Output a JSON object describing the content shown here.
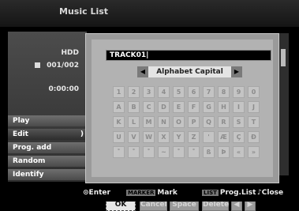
{
  "title": "Music List",
  "info": {
    "source": "HDD",
    "track_count": "001/002",
    "time": "0:00:00"
  },
  "menu": [
    {
      "label": "Play"
    },
    {
      "label": "Edit",
      "arrow": ")"
    },
    {
      "label": "Prog. add"
    },
    {
      "label": "Random"
    },
    {
      "label": "Identify"
    }
  ],
  "dialog": {
    "name_value": "TRACK01",
    "mode_label": "Alphabet Capital",
    "mode_left": "◀",
    "mode_right": "▶",
    "keys": [
      [
        "1",
        "2",
        "3",
        "4",
        "5",
        "6",
        "7",
        "8",
        "9",
        "0"
      ],
      [
        "A",
        "B",
        "C",
        "D",
        "E",
        "F",
        "G",
        "H",
        "I",
        "J"
      ],
      [
        "K",
        "L",
        "M",
        "N",
        "O",
        "P",
        "Q",
        "R",
        "S",
        "T"
      ],
      [
        "U",
        "V",
        "W",
        "X",
        "Y",
        "Z",
        "'",
        "Æ",
        "Ç",
        "Ð"
      ],
      [
        "˚",
        "˚",
        "˚",
        "~",
        "˚",
        "˚",
        "ß",
        "Þ",
        "«",
        "»"
      ]
    ],
    "buttons": {
      "ok": "OK",
      "cancel": "Cancel",
      "space": "Space",
      "delete": "Delete",
      "left": "◀",
      "right": "▶"
    }
  },
  "status": {
    "enter_icon": "⊙",
    "enter": "Enter",
    "marker_key": "MARKER",
    "mark": "Mark",
    "list_key": "LIST",
    "prog_list": "Prog.List",
    "close_icon": "♪",
    "close": "Close"
  }
}
